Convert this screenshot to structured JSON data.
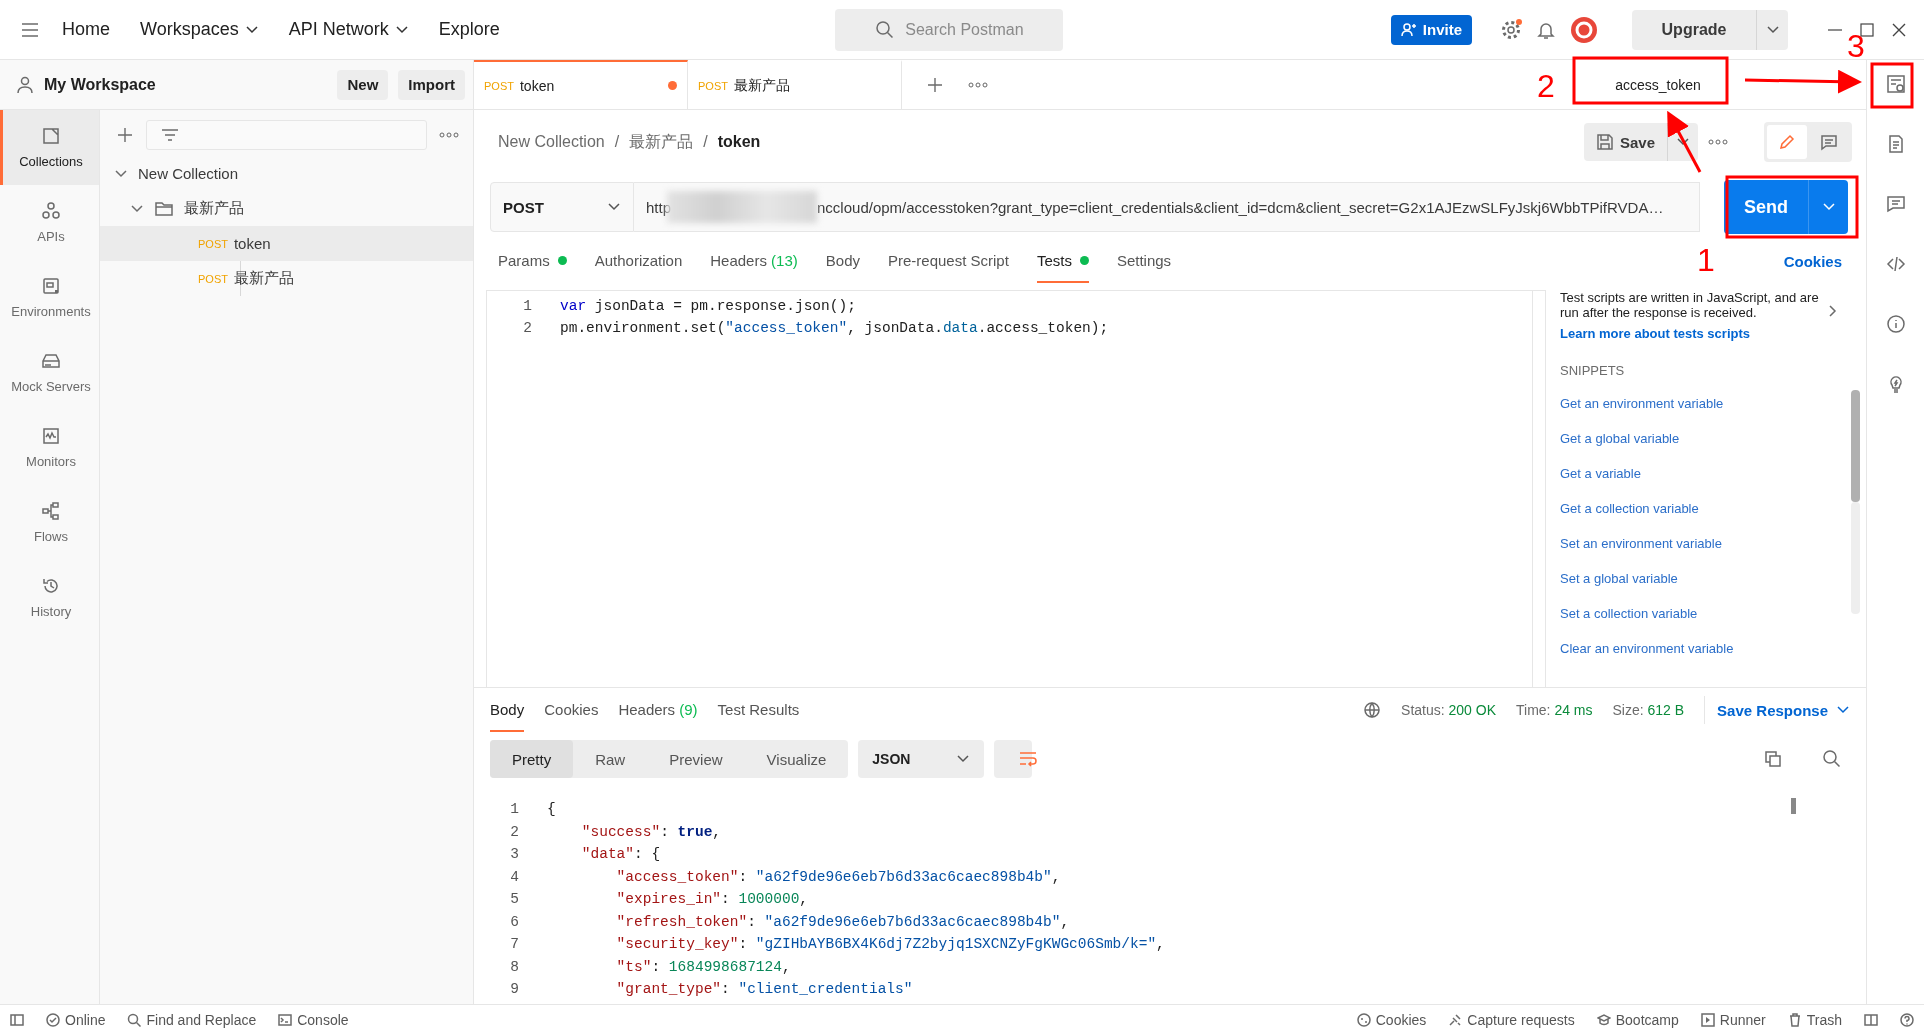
{
  "topbar": {
    "nav": [
      {
        "label": "Home",
        "dropdown": false
      },
      {
        "label": "Workspaces",
        "dropdown": true
      },
      {
        "label": "API Network",
        "dropdown": true
      },
      {
        "label": "Explore",
        "dropdown": false
      }
    ],
    "search": {
      "placeholder": "Search Postman"
    },
    "invite": "Invite",
    "upgrade": "Upgrade"
  },
  "workspace": {
    "title": "My Workspace",
    "buttons": [
      "New",
      "Import"
    ]
  },
  "sidebar": {
    "items": [
      {
        "label": "Collections",
        "selected": true
      },
      {
        "label": "APIs",
        "selected": false
      },
      {
        "label": "Environments",
        "selected": false
      },
      {
        "label": "Mock Servers",
        "selected": false
      },
      {
        "label": "Monitors",
        "selected": false
      },
      {
        "label": "Flows",
        "selected": false
      },
      {
        "label": "History",
        "selected": false
      }
    ]
  },
  "tree": [
    {
      "name": "New Collection",
      "expanded": true,
      "children": [
        {
          "name": "最新产品",
          "expanded": true,
          "children": [
            {
              "method": "POST",
              "name": "token",
              "selected": true
            },
            {
              "method": "POST",
              "name": "最新产品",
              "selected": false
            }
          ]
        }
      ]
    }
  ],
  "tabs": [
    {
      "method": "POST",
      "name": "token",
      "selected": true,
      "unsaved": true
    },
    {
      "method": "POST",
      "name": "最新产品",
      "selected": false,
      "unsaved": false
    }
  ],
  "environment": "access_token",
  "breadcrumb": [
    {
      "kind": "crumb",
      "text": "New Collection"
    },
    {
      "kind": "separator",
      "text": "/"
    },
    {
      "kind": "crumb",
      "text": "最新产品"
    },
    {
      "kind": "separator",
      "text": "/"
    },
    {
      "kind": "current",
      "text": "token"
    }
  ],
  "save": "Save",
  "request": {
    "method": "POST",
    "url_start": "http",
    "url_end": "nccloud/opm/accesstoken?grant_type=client_credentials&client_id=dcm&client_secret=G2x1AJEzwSLFyJskj6WbbTPifRVDA…",
    "send": "Send"
  },
  "request_tabs": [
    {
      "label": "Params",
      "dot": true,
      "selected": false
    },
    {
      "label": "Authorization",
      "dot": false,
      "selected": false
    },
    {
      "label": "Headers",
      "count": "(13)",
      "dot": false,
      "selected": false
    },
    {
      "label": "Body",
      "dot": false,
      "selected": false
    },
    {
      "label": "Pre-request Script",
      "dot": false,
      "selected": false
    },
    {
      "label": "Tests",
      "dot": true,
      "selected": true
    },
    {
      "label": "Settings",
      "dot": false,
      "selected": false
    }
  ],
  "cookies_link": "Cookies",
  "editor": {
    "lines": [
      {
        "number": "1",
        "tokens": [
          {
            "kind": "keyword",
            "text": "var "
          },
          {
            "kind": "plain",
            "text": "jsonData = pm.response.json();"
          }
        ]
      },
      {
        "number": "2",
        "tokens": [
          {
            "kind": "plain",
            "text": "pm.environment.set("
          },
          {
            "kind": "string",
            "text": "\"access_token\""
          },
          {
            "kind": "plain",
            "text": ", jsonData."
          },
          {
            "kind": "property",
            "text": "data"
          },
          {
            "kind": "plain",
            "text": ".access_token);"
          }
        ]
      }
    ]
  },
  "snippets": {
    "help": "Test scripts are written in JavaScript, and are run after the response is received.",
    "link": "Learn more about tests scripts",
    "heading": "SNIPPETS",
    "items": [
      "Get an environment variable",
      "Get a global variable",
      "Get a variable",
      "Get a collection variable",
      "Set an environment variable",
      "Set a global variable",
      "Set a collection variable",
      "Clear an environment variable"
    ]
  },
  "response": {
    "tabs": [
      {
        "label": "Body",
        "selected": true
      },
      {
        "label": "Cookies",
        "selected": false
      },
      {
        "label": "Headers",
        "count": "(9)",
        "selected": false
      },
      {
        "label": "Test Results",
        "selected": false
      }
    ],
    "status": [
      {
        "label": "Status:",
        "value": "200 OK"
      },
      {
        "label": "Time:",
        "value": "24 ms"
      },
      {
        "label": "Size:",
        "value": "612 B"
      }
    ],
    "save_response": "Save Response",
    "views": [
      {
        "label": "Pretty",
        "selected": true
      },
      {
        "label": "Raw",
        "selected": false
      },
      {
        "label": "Preview",
        "selected": false
      },
      {
        "label": "Visualize",
        "selected": false
      }
    ],
    "format": "JSON",
    "lines": [
      {
        "number": "1",
        "tokens": [
          {
            "kind": "plain",
            "text": "{"
          }
        ]
      },
      {
        "number": "2",
        "tokens": [
          {
            "kind": "key",
            "text": "    \"success\""
          },
          {
            "kind": "plain",
            "text": ": "
          },
          {
            "kind": "bool",
            "text": "true"
          },
          {
            "kind": "plain",
            "text": ","
          }
        ]
      },
      {
        "number": "3",
        "tokens": [
          {
            "kind": "key",
            "text": "    \"data\""
          },
          {
            "kind": "plain",
            "text": ": {"
          }
        ]
      },
      {
        "number": "4",
        "tokens": [
          {
            "kind": "key",
            "text": "        \"access_token\""
          },
          {
            "kind": "plain",
            "text": ": "
          },
          {
            "kind": "string",
            "text": "\"a62f9de96e6eb7b6d33ac6caec898b4b\""
          },
          {
            "kind": "plain",
            "text": ","
          }
        ]
      },
      {
        "number": "5",
        "tokens": [
          {
            "kind": "key",
            "text": "        \"expires_in\""
          },
          {
            "kind": "plain",
            "text": ": "
          },
          {
            "kind": "number",
            "text": "1000000"
          },
          {
            "kind": "plain",
            "text": ","
          }
        ]
      },
      {
        "number": "6",
        "tokens": [
          {
            "kind": "key",
            "text": "        \"refresh_token\""
          },
          {
            "kind": "plain",
            "text": ": "
          },
          {
            "kind": "string",
            "text": "\"a62f9de96e6eb7b6d33ac6caec898b4b\""
          },
          {
            "kind": "plain",
            "text": ","
          }
        ]
      },
      {
        "number": "7",
        "tokens": [
          {
            "kind": "key",
            "text": "        \"security_key\""
          },
          {
            "kind": "plain",
            "text": ": "
          },
          {
            "kind": "string",
            "text": "\"gZIHbAYB6BX4K6dj7Z2byjq1SXCNZyFgKWGc06Smb/k=\""
          },
          {
            "kind": "plain",
            "text": ","
          }
        ]
      },
      {
        "number": "8",
        "tokens": [
          {
            "kind": "key",
            "text": "        \"ts\""
          },
          {
            "kind": "plain",
            "text": ": "
          },
          {
            "kind": "number",
            "text": "1684998687124"
          },
          {
            "kind": "plain",
            "text": ","
          }
        ]
      },
      {
        "number": "9",
        "tokens": [
          {
            "kind": "key",
            "text": "        \"grant_type\""
          },
          {
            "kind": "plain",
            "text": ": "
          },
          {
            "kind": "string",
            "text": "\"client_credentials\""
          }
        ]
      }
    ]
  },
  "statusbar": {
    "left": [
      "Online",
      "Find and Replace",
      "Console"
    ],
    "right": [
      "Cookies",
      "Capture requests",
      "Bootcamp",
      "Runner",
      "Trash"
    ]
  },
  "annotations": [
    "1",
    "2",
    "3"
  ]
}
